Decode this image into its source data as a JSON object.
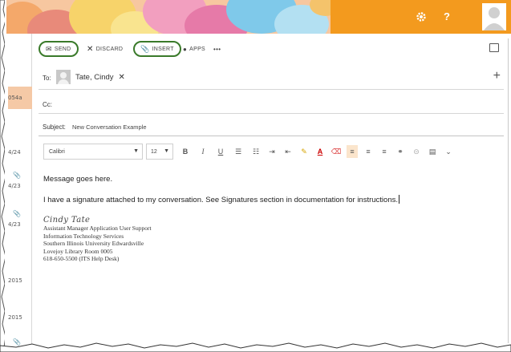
{
  "rail": {
    "items": [
      {
        "text": "054a"
      },
      {
        "text": "4/24"
      },
      {
        "text": "4/23"
      },
      {
        "text": "4/23"
      },
      {
        "text": "2015"
      },
      {
        "text": "2015"
      }
    ]
  },
  "header": {
    "settings_icon": "gear-icon",
    "help_label": "?",
    "colors": {
      "banner_orange": "#f39a1e",
      "accent_green": "#3a7a2a"
    }
  },
  "toolbar": {
    "send_label": "SEND",
    "discard_label": "DISCARD",
    "insert_label": "INSERT",
    "apps_label": "APPS",
    "more_label": "•••"
  },
  "to_field": {
    "label": "To:",
    "recipient": "Tate, Cindy",
    "remove": "✕",
    "add": "+"
  },
  "cc_field": {
    "label": "Cc:"
  },
  "subject_field": {
    "label": "Subject:",
    "value": "New Conversation Example"
  },
  "format": {
    "font": "Calibri",
    "size": "12",
    "bold": "B",
    "italic": "I",
    "underline": "U",
    "font_color": "A"
  },
  "body": {
    "line1": "Message goes here.",
    "line2": "I have a signature attached to my conversation. See Signatures section in documentation for instructions."
  },
  "signature": {
    "name": "Cindy Tate",
    "lines": [
      "Assistant Manager Application User Support",
      "Information Technology Services",
      "Southern Illinois University Edwardsville",
      "Lovejoy Library Room 0005",
      "618-650-5500 (ITS Help Desk)"
    ]
  }
}
